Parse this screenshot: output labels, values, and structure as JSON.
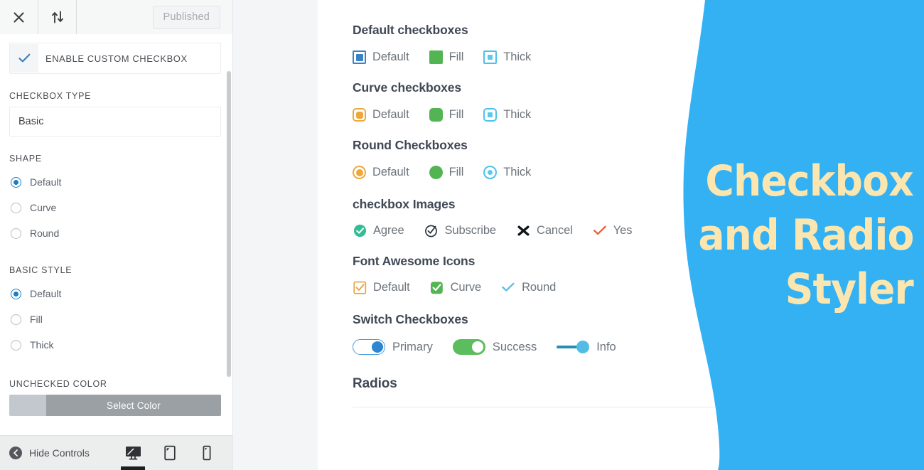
{
  "customizer": {
    "topbar": {
      "close_icon": "close-icon",
      "sort_icon": "sort-arrows-icon",
      "publish_label": "Published"
    },
    "enable_toggle": {
      "label": "ENABLE CUSTOM CHECKBOX",
      "checked": true,
      "check_icon": "check-icon",
      "check_color": "#2f7fc4"
    },
    "checkbox_type": {
      "label": "CHECKBOX TYPE",
      "value": "Basic"
    },
    "shape": {
      "label": "SHAPE",
      "selected": "Default",
      "options": [
        "Default",
        "Curve",
        "Round"
      ]
    },
    "basic_style": {
      "label": "BASIC STYLE",
      "selected": "Default",
      "options": [
        "Default",
        "Fill",
        "Thick"
      ]
    },
    "unchecked_color": {
      "label": "UNCHECKED COLOR",
      "button_label": "Select Color",
      "swatch_color": "#c2c8cd",
      "button_color": "#9aa0a4"
    },
    "footer": {
      "hide_controls_label": "Hide Controls",
      "back_icon": "chevron-left-icon",
      "devices": [
        {
          "name": "desktop-preview-icon",
          "active": true
        },
        {
          "name": "tablet-preview-icon",
          "active": false
        },
        {
          "name": "mobile-preview-icon",
          "active": false
        }
      ]
    }
  },
  "preview": {
    "groups": [
      {
        "title": "Default checkboxes",
        "items": [
          {
            "label": "Default",
            "style": "box sq outline-blue",
            "icon": "checkbox-default-square-icon"
          },
          {
            "label": "Fill",
            "style": "box sq fill-green",
            "icon": "checkbox-fill-square-icon"
          },
          {
            "label": "Thick",
            "style": "box sq thick-blue",
            "icon": "checkbox-thick-square-icon"
          }
        ]
      },
      {
        "title": "Curve checkboxes",
        "items": [
          {
            "label": "Default",
            "style": "box curve outline-orange",
            "icon": "checkbox-curve-default-icon"
          },
          {
            "label": "Fill",
            "style": "box curve fill-green",
            "icon": "checkbox-curve-fill-icon"
          },
          {
            "label": "Thick",
            "style": "box curve thick-blue",
            "icon": "checkbox-curve-thick-icon"
          }
        ]
      },
      {
        "title": "Round Checkboxes",
        "items": [
          {
            "label": "Default",
            "style": "box round outline-orange",
            "icon": "checkbox-round-default-icon"
          },
          {
            "label": "Fill",
            "style": "box round fill-green",
            "icon": "checkbox-round-fill-icon"
          },
          {
            "label": "Thick",
            "style": "box round thick-blue",
            "icon": "checkbox-round-thick-icon"
          }
        ]
      },
      {
        "title": "checkbox Images",
        "items": [
          {
            "label": "Agree",
            "icon": "check-circle-filled-icon",
            "color": "#34bd94"
          },
          {
            "label": "Subscribe",
            "icon": "check-circle-outline-icon",
            "color": "#2f3640"
          },
          {
            "label": "Cancel",
            "icon": "x-bold-icon",
            "color": "#111518"
          },
          {
            "label": "Yes",
            "icon": "check-mark-icon",
            "color": "#e85c36"
          }
        ]
      },
      {
        "title": "Font Awesome Icons",
        "items": [
          {
            "label": "Default",
            "icon": "fa-check-square-outline-orange-icon",
            "color": "#e8a33d"
          },
          {
            "label": "Curve",
            "icon": "fa-check-square-filled-green-icon",
            "color": "#52b453"
          },
          {
            "label": "Round",
            "icon": "fa-check-blue-icon",
            "color": "#5bbde2"
          }
        ]
      },
      {
        "title": "Switch Checkboxes",
        "items": [
          {
            "label": "Primary",
            "icon": "switch-primary-icon",
            "state": "on"
          },
          {
            "label": "Success",
            "icon": "switch-success-icon",
            "state": "on"
          },
          {
            "label": "Info",
            "icon": "switch-info-icon",
            "state": "on"
          }
        ]
      },
      {
        "title": "Radios",
        "items": []
      }
    ]
  },
  "overlay": {
    "lines": [
      "Checkbox",
      "and Radio",
      "Styler"
    ],
    "background_color": "#33b1f3",
    "text_color": "#fbe6b0"
  }
}
